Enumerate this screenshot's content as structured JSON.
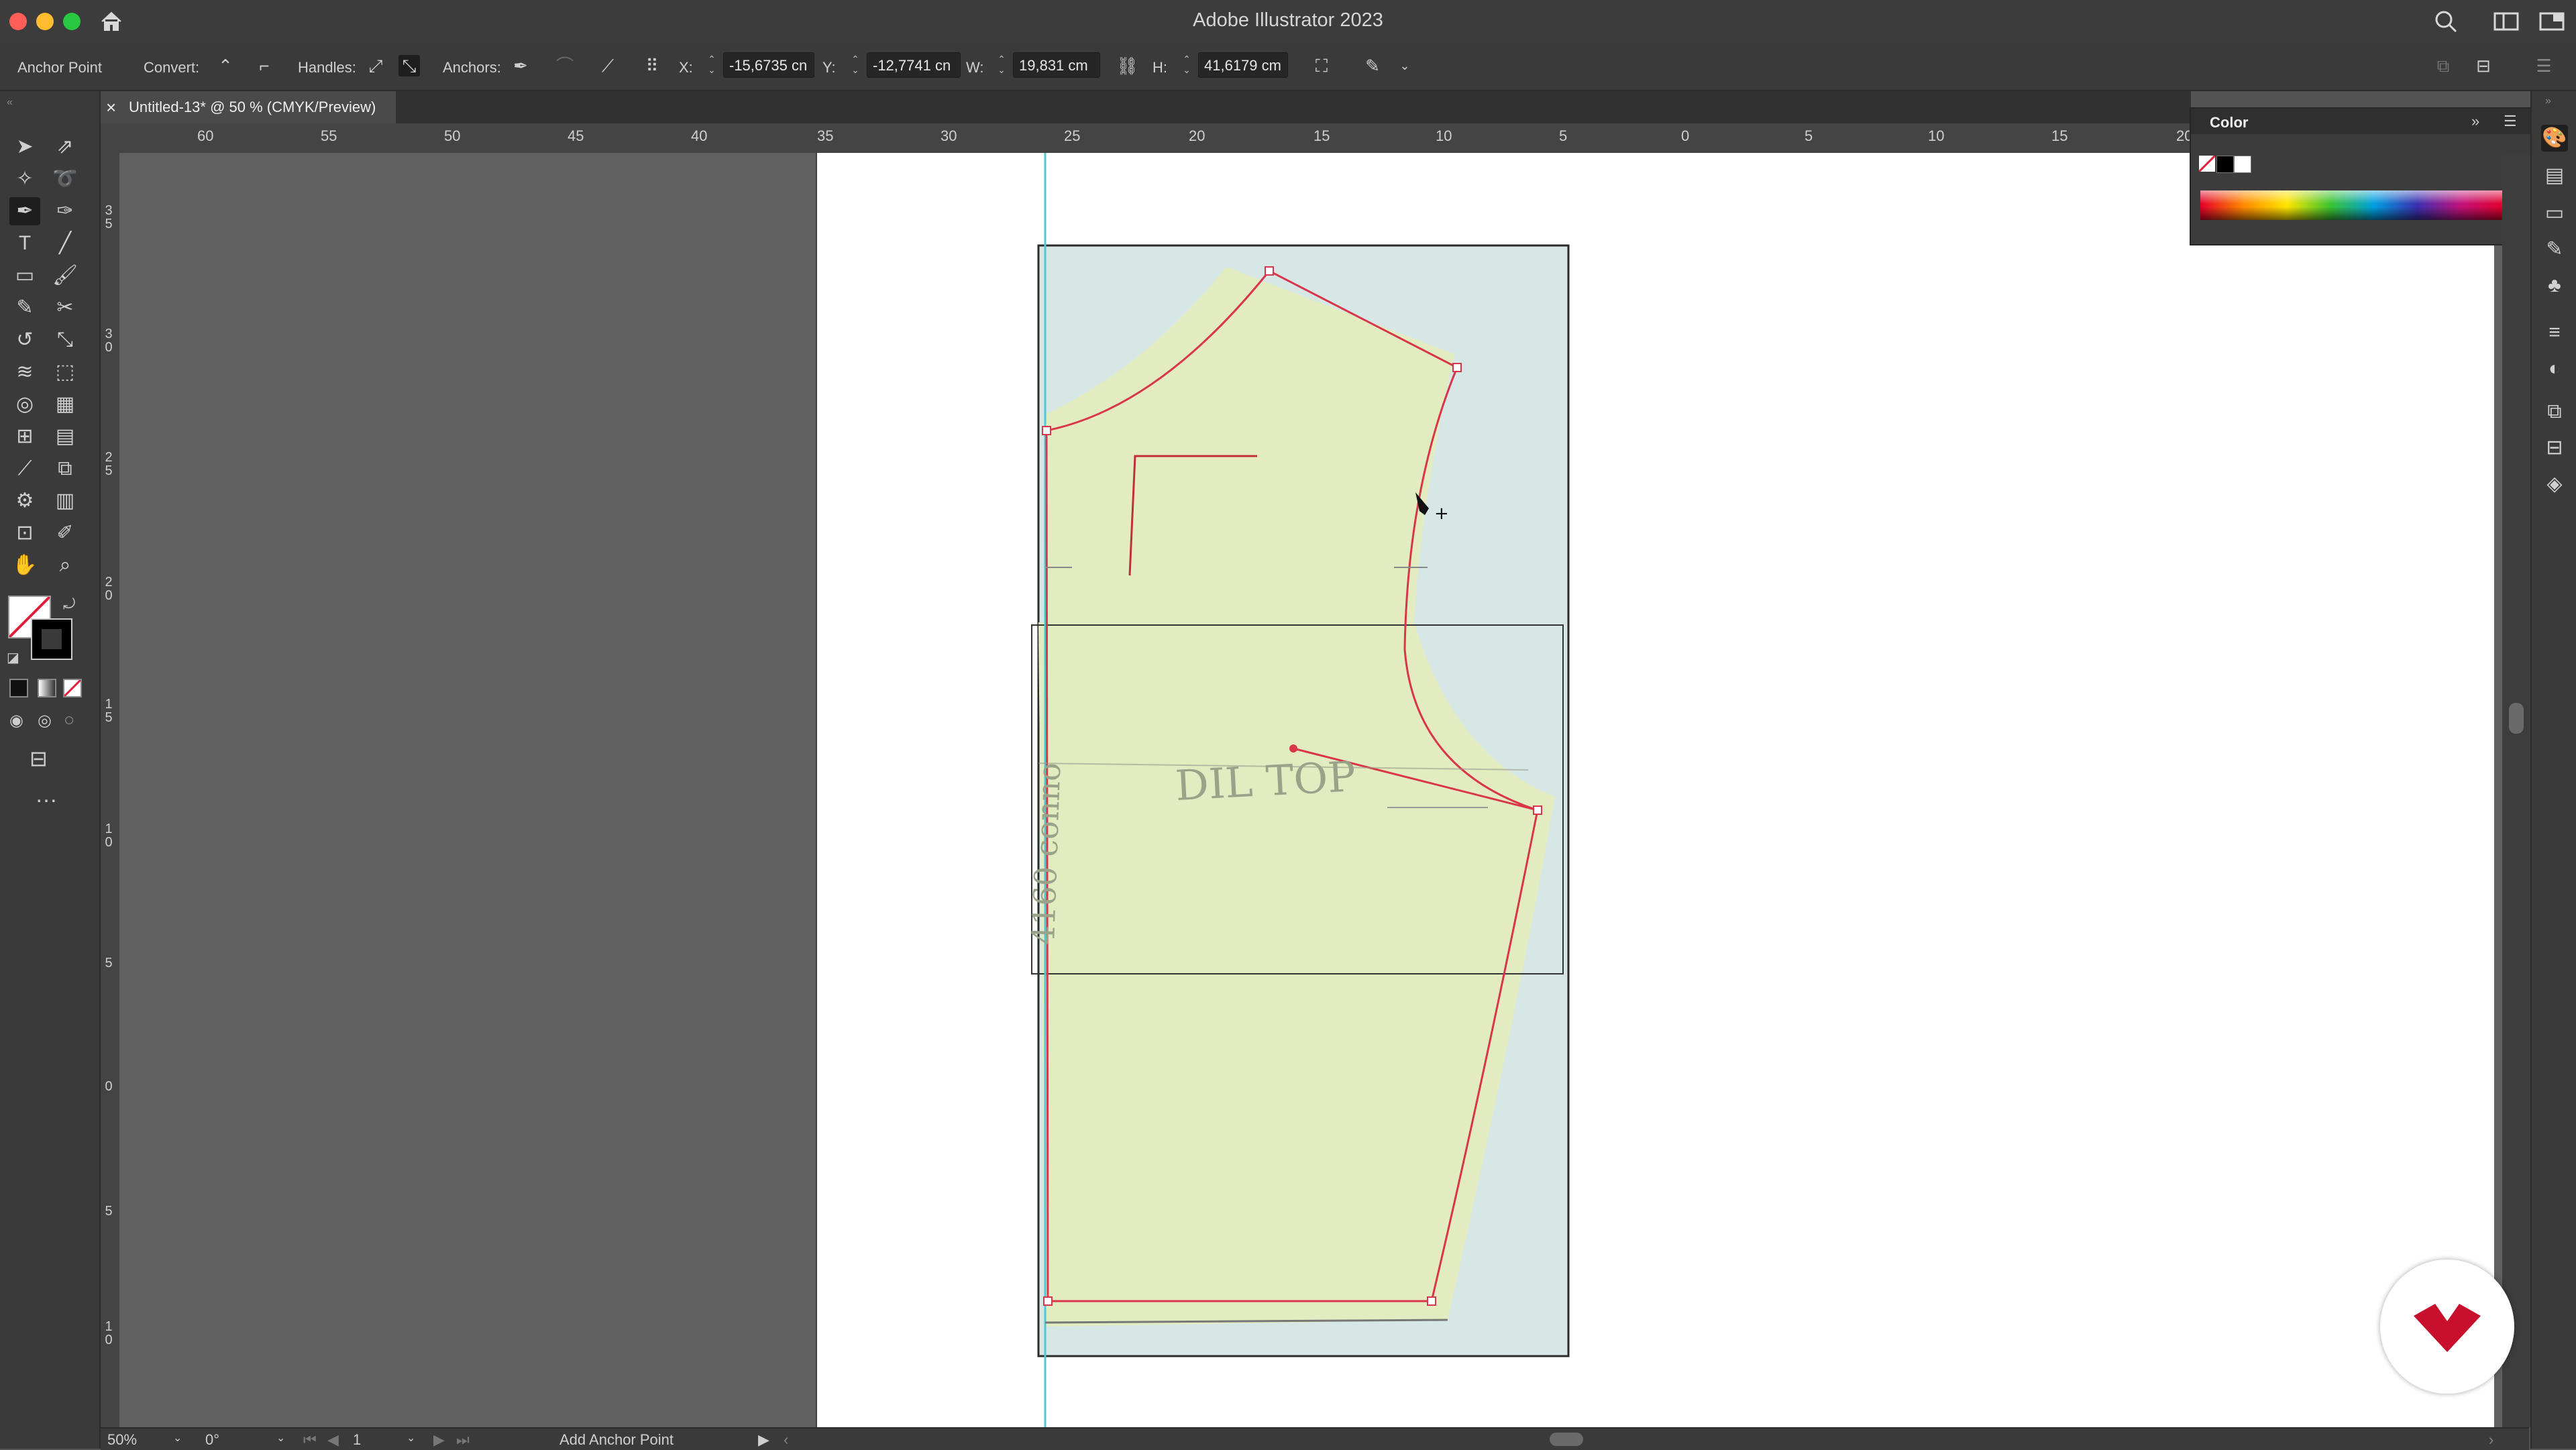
{
  "window": {
    "title": "Adobe Illustrator 2023"
  },
  "control_bar": {
    "tool_name": "Anchor Point",
    "convert_label": "Convert:",
    "handles_label": "Handles:",
    "anchors_label": "Anchors:",
    "x_label": "X:",
    "x_value": "-15,6735 cn",
    "y_label": "Y:",
    "y_value": "-12,7741 cn",
    "w_label": "W:",
    "w_value": "19,831 cm",
    "h_label": "H:",
    "h_value": "41,6179 cm"
  },
  "document": {
    "tab_title": "Untitled-13* @ 50 % (CMYK/Preview)",
    "close_glyph": "×"
  },
  "rulers": {
    "horizontal": [
      "60",
      "55",
      "50",
      "45",
      "40",
      "35",
      "30",
      "25",
      "20",
      "15",
      "10",
      "5",
      "0",
      "5",
      "10",
      "15",
      "20"
    ],
    "vertical": [
      "3\n5",
      "3\n0",
      "2\n5",
      "2\n0",
      "1\n5",
      "1\n0",
      "5",
      "0",
      "5",
      "1\n0"
    ]
  },
  "artwork": {
    "handwritten_label": "DIL TOP",
    "side_note": "4160 conno"
  },
  "color_panel": {
    "title": "Color",
    "colors": {
      "stroke": "#e0203a",
      "fill_none": "#ffffff",
      "black": "#000000",
      "white": "#ffffff"
    }
  },
  "status_bar": {
    "zoom": "50%",
    "rotation": "0°",
    "artboard_number": "1",
    "current_tool": "Add Anchor Point"
  },
  "toolbar": {
    "more_glyph": "…"
  },
  "colors": {
    "accent_path": "#d9364a",
    "paper_fill": "#e3edbf",
    "backing": "#d6e6e6",
    "guide": "#4ec9d6"
  }
}
